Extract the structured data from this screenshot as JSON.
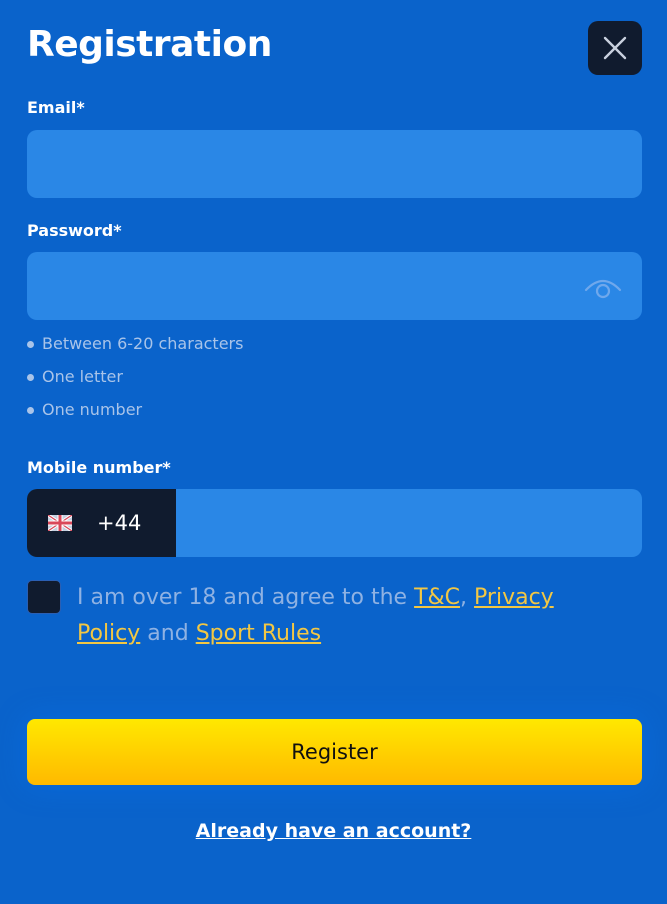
{
  "dialog": {
    "title": "Registration",
    "close_icon": "close-icon"
  },
  "email": {
    "label": "Email*",
    "value": "",
    "placeholder": ""
  },
  "password": {
    "label": "Password*",
    "value": "",
    "placeholder": "",
    "toggle_icon": "eye-icon",
    "rules": [
      "Between 6-20 characters",
      "One letter",
      "One number"
    ]
  },
  "mobile": {
    "label": "Mobile number*",
    "flag_icon": "uk-flag-icon",
    "country_code": "+44",
    "value": "",
    "placeholder": ""
  },
  "agreement": {
    "checked": false,
    "text_before": "I am over 18 and agree to the ",
    "link_tc": "T&C",
    "sep": ", ",
    "link_privacy": "Privacy Policy",
    "text_and": " and ",
    "link_sport": "Sport Rules"
  },
  "actions": {
    "register_label": "Register",
    "login_link": "Already have an account?"
  },
  "colors": {
    "background": "#0a63cb",
    "field": "#2a87e6",
    "dark": "#101b2e",
    "accent_link": "#f2c744",
    "button": "#ffd700"
  }
}
